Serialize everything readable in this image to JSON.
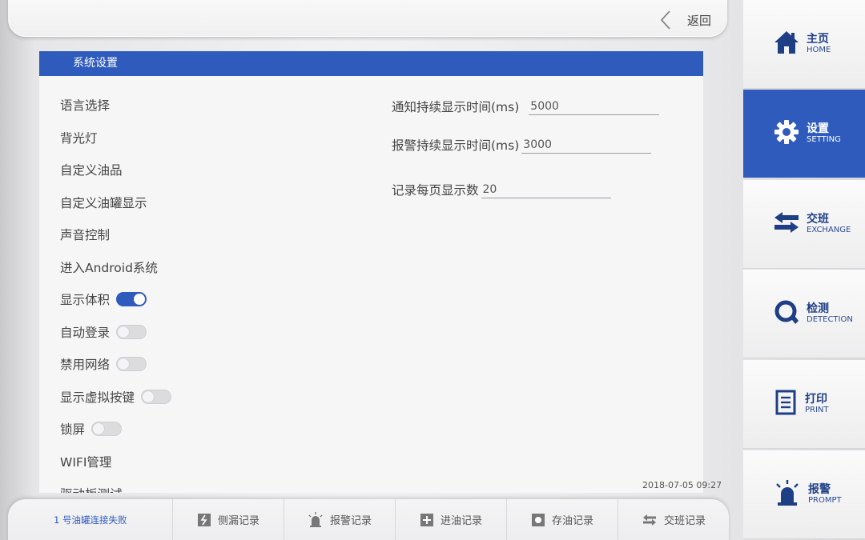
{
  "topbar": {
    "back_label": "返回"
  },
  "panel": {
    "title": "系统设置",
    "menu": [
      {
        "label": "语言选择"
      },
      {
        "label": "背光灯"
      },
      {
        "label": "自定义油品"
      },
      {
        "label": "自定义油罐显示"
      },
      {
        "label": "声音控制"
      },
      {
        "label": "进入Android系统"
      },
      {
        "label": "显示体积",
        "toggle": true,
        "on": true
      },
      {
        "label": "自动登录",
        "toggle": true,
        "on": false
      },
      {
        "label": "禁用网络",
        "toggle": true,
        "on": false
      },
      {
        "label": "显示虚拟按键",
        "toggle": true,
        "on": false
      },
      {
        "label": "锁屏",
        "toggle": true,
        "on": false
      },
      {
        "label": "WIFI管理"
      },
      {
        "label": "驱动板测试"
      }
    ],
    "fields": {
      "notify_label": "通知持续显示时间(ms)",
      "notify_value": "5000",
      "alarm_label": "报警持续显示时间(ms)",
      "alarm_value": "3000",
      "records_label": "记录每页显示数",
      "records_value": "20"
    }
  },
  "datetime": "2018-07-05 09:27",
  "bottombar": {
    "status": "1 号油罐连接失败",
    "buttons": [
      {
        "label": "侧漏记录",
        "icon": "leak-icon"
      },
      {
        "label": "报警记录",
        "icon": "alarm-icon"
      },
      {
        "label": "进油记录",
        "icon": "oil-in-icon"
      },
      {
        "label": "存油记录",
        "icon": "oil-store-icon"
      },
      {
        "label": "交班记录",
        "icon": "exchange-icon"
      }
    ]
  },
  "sidenav": [
    {
      "zh": "主页",
      "en": "HOME",
      "icon": "home-icon"
    },
    {
      "zh": "设置",
      "en": "SETTING",
      "icon": "gear-icon",
      "active": true
    },
    {
      "zh": "交班",
      "en": "EXCHANGE",
      "icon": "exchange-arrows-icon"
    },
    {
      "zh": "检测",
      "en": "DETECTION",
      "icon": "detection-icon"
    },
    {
      "zh": "打印",
      "en": "PRINT",
      "icon": "print-icon"
    },
    {
      "zh": "报警",
      "en": "PROMPT",
      "icon": "alarm-light-icon"
    }
  ],
  "colors": {
    "accent": "#2f5bbd",
    "nav_text": "#1e3f86"
  }
}
